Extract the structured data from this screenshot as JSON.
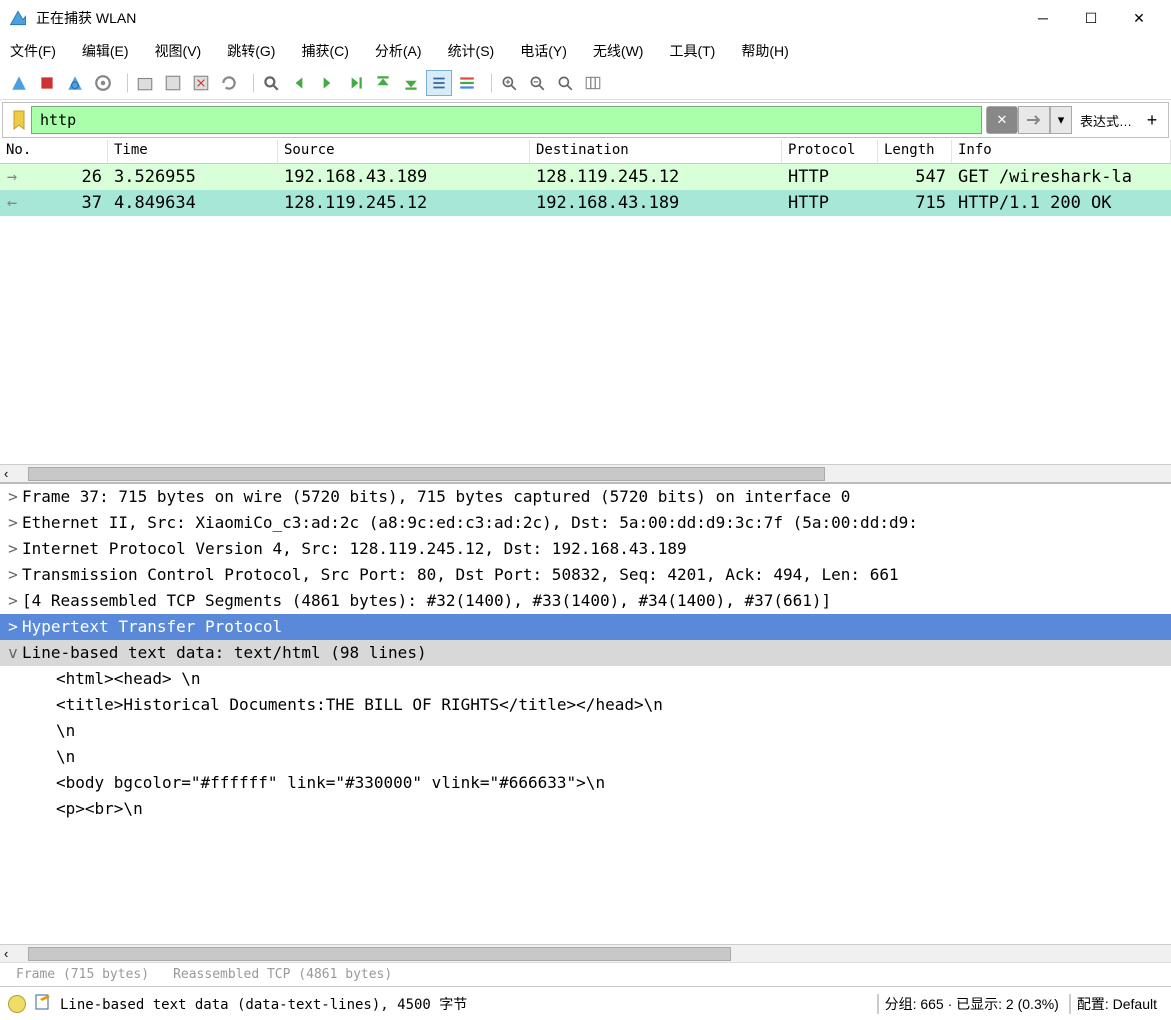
{
  "window": {
    "title": "正在捕获 WLAN"
  },
  "menubar": [
    "文件(F)",
    "编辑(E)",
    "视图(V)",
    "跳转(G)",
    "捕获(C)",
    "分析(A)",
    "统计(S)",
    "电话(Y)",
    "无线(W)",
    "工具(T)",
    "帮助(H)"
  ],
  "filter": {
    "value": "http",
    "expr_label": "表达式…"
  },
  "packet_columns": {
    "no": "No.",
    "time": "Time",
    "source": "Source",
    "dest": "Destination",
    "proto": "Protocol",
    "length": "Length",
    "info": "Info"
  },
  "packets": [
    {
      "no": "26",
      "time": "3.526955",
      "src": "192.168.43.189",
      "dst": "128.119.245.12",
      "proto": "HTTP",
      "len": "547",
      "info": "GET /wireshark-la"
    },
    {
      "no": "37",
      "time": "4.849634",
      "src": "128.119.245.12",
      "dst": "192.168.43.189",
      "proto": "HTTP",
      "len": "715",
      "info": "HTTP/1.1 200 OK"
    }
  ],
  "detail_lines": [
    {
      "exp": ">",
      "text": "Frame 37: 715 bytes on wire (5720 bits), 715 bytes captured (5720 bits) on interface 0"
    },
    {
      "exp": ">",
      "text": "Ethernet II, Src: XiaomiCo_c3:ad:2c (a8:9c:ed:c3:ad:2c), Dst: 5a:00:dd:d9:3c:7f (5a:00:dd:d9:"
    },
    {
      "exp": ">",
      "text": "Internet Protocol Version 4, Src: 128.119.245.12, Dst: 192.168.43.189"
    },
    {
      "exp": ">",
      "text": "Transmission Control Protocol, Src Port: 80, Dst Port: 50832, Seq: 4201, Ack: 494, Len: 661"
    },
    {
      "exp": ">",
      "text": "[4 Reassembled TCP Segments (4861 bytes): #32(1400), #33(1400), #34(1400), #37(661)]"
    },
    {
      "exp": ">",
      "text": "Hypertext Transfer Protocol",
      "selected": true
    },
    {
      "exp": "v",
      "text": "Line-based text data: text/html (98 lines)",
      "gray": true
    }
  ],
  "content_lines": [
    "<html><head> \\n",
    "<title>Historical Documents:THE BILL OF RIGHTS</title></head>\\n",
    "\\n",
    "\\n",
    "<body bgcolor=\"#ffffff\" link=\"#330000\" vlink=\"#666633\">\\n",
    "<p><br>\\n"
  ],
  "tabs": {
    "frame": "Frame (715 bytes)",
    "reassembled": "Reassembled TCP (4861 bytes)"
  },
  "status": {
    "main": "Line-based text data (data-text-lines), 4500 字节",
    "packets": "分组: 665 · 已显示: 2 (0.3%)",
    "profile": "配置: Default"
  }
}
